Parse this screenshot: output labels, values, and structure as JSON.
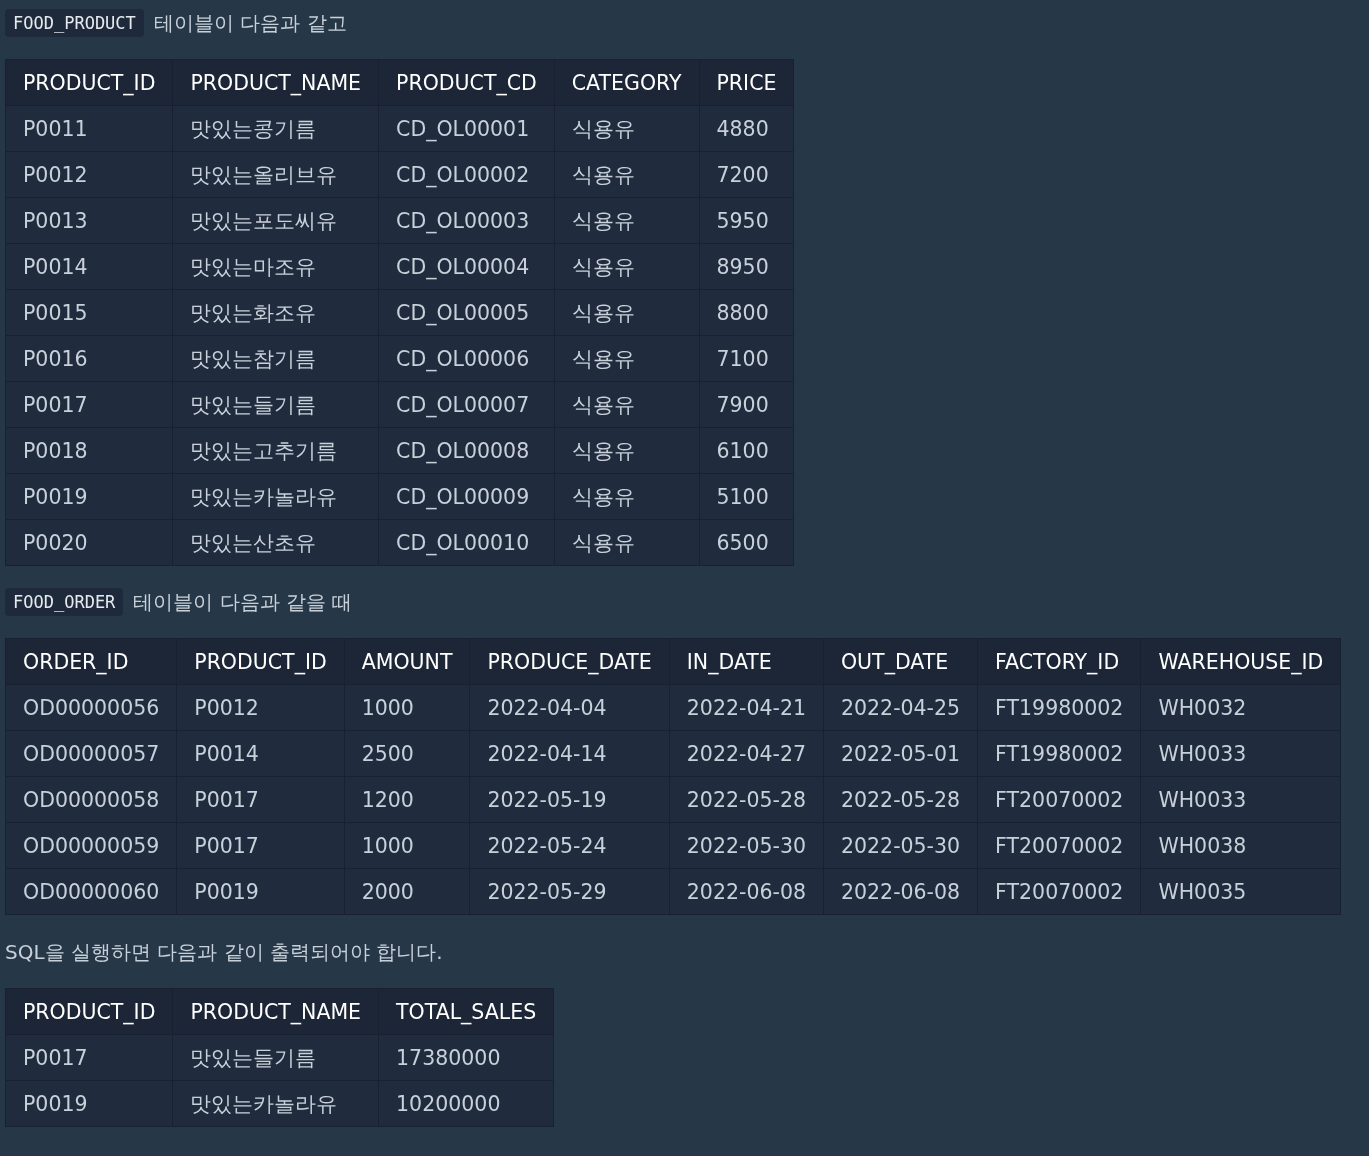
{
  "blocks": [
    {
      "kind": "caption",
      "code": "FOOD_PRODUCT",
      "text": "테이블이 다음과 같고"
    },
    {
      "kind": "table",
      "columns": [
        "PRODUCT_ID",
        "PRODUCT_NAME",
        "PRODUCT_CD",
        "CATEGORY",
        "PRICE"
      ],
      "rows": [
        [
          "P0011",
          "맛있는콩기름",
          "CD_OL00001",
          "식용유",
          "4880"
        ],
        [
          "P0012",
          "맛있는올리브유",
          "CD_OL00002",
          "식용유",
          "7200"
        ],
        [
          "P0013",
          "맛있는포도씨유",
          "CD_OL00003",
          "식용유",
          "5950"
        ],
        [
          "P0014",
          "맛있는마조유",
          "CD_OL00004",
          "식용유",
          "8950"
        ],
        [
          "P0015",
          "맛있는화조유",
          "CD_OL00005",
          "식용유",
          "8800"
        ],
        [
          "P0016",
          "맛있는참기름",
          "CD_OL00006",
          "식용유",
          "7100"
        ],
        [
          "P0017",
          "맛있는들기름",
          "CD_OL00007",
          "식용유",
          "7900"
        ],
        [
          "P0018",
          "맛있는고추기름",
          "CD_OL00008",
          "식용유",
          "6100"
        ],
        [
          "P0019",
          "맛있는카놀라유",
          "CD_OL00009",
          "식용유",
          "5100"
        ],
        [
          "P0020",
          "맛있는산초유",
          "CD_OL00010",
          "식용유",
          "6500"
        ]
      ]
    },
    {
      "kind": "caption",
      "code": "FOOD_ORDER",
      "text": "테이블이 다음과 같을 때"
    },
    {
      "kind": "table",
      "columns": [
        "ORDER_ID",
        "PRODUCT_ID",
        "AMOUNT",
        "PRODUCE_DATE",
        "IN_DATE",
        "OUT_DATE",
        "FACTORY_ID",
        "WAREHOUSE_ID"
      ],
      "rows": [
        [
          "OD00000056",
          "P0012",
          "1000",
          "2022-04-04",
          "2022-04-21",
          "2022-04-25",
          "FT19980002",
          "WH0032"
        ],
        [
          "OD00000057",
          "P0014",
          "2500",
          "2022-04-14",
          "2022-04-27",
          "2022-05-01",
          "FT19980002",
          "WH0033"
        ],
        [
          "OD00000058",
          "P0017",
          "1200",
          "2022-05-19",
          "2022-05-28",
          "2022-05-28",
          "FT20070002",
          "WH0033"
        ],
        [
          "OD00000059",
          "P0017",
          "1000",
          "2022-05-24",
          "2022-05-30",
          "2022-05-30",
          "FT20070002",
          "WH0038"
        ],
        [
          "OD00000060",
          "P0019",
          "2000",
          "2022-05-29",
          "2022-06-08",
          "2022-06-08",
          "FT20070002",
          "WH0035"
        ]
      ]
    },
    {
      "kind": "paragraph",
      "text": "SQL을 실행하면 다음과 같이 출력되어야 합니다."
    },
    {
      "kind": "table",
      "columns": [
        "PRODUCT_ID",
        "PRODUCT_NAME",
        "TOTAL_SALES"
      ],
      "rows": [
        [
          "P0017",
          "맛있는들기름",
          "17380000"
        ],
        [
          "P0019",
          "맛있는카놀라유",
          "10200000"
        ]
      ]
    }
  ]
}
